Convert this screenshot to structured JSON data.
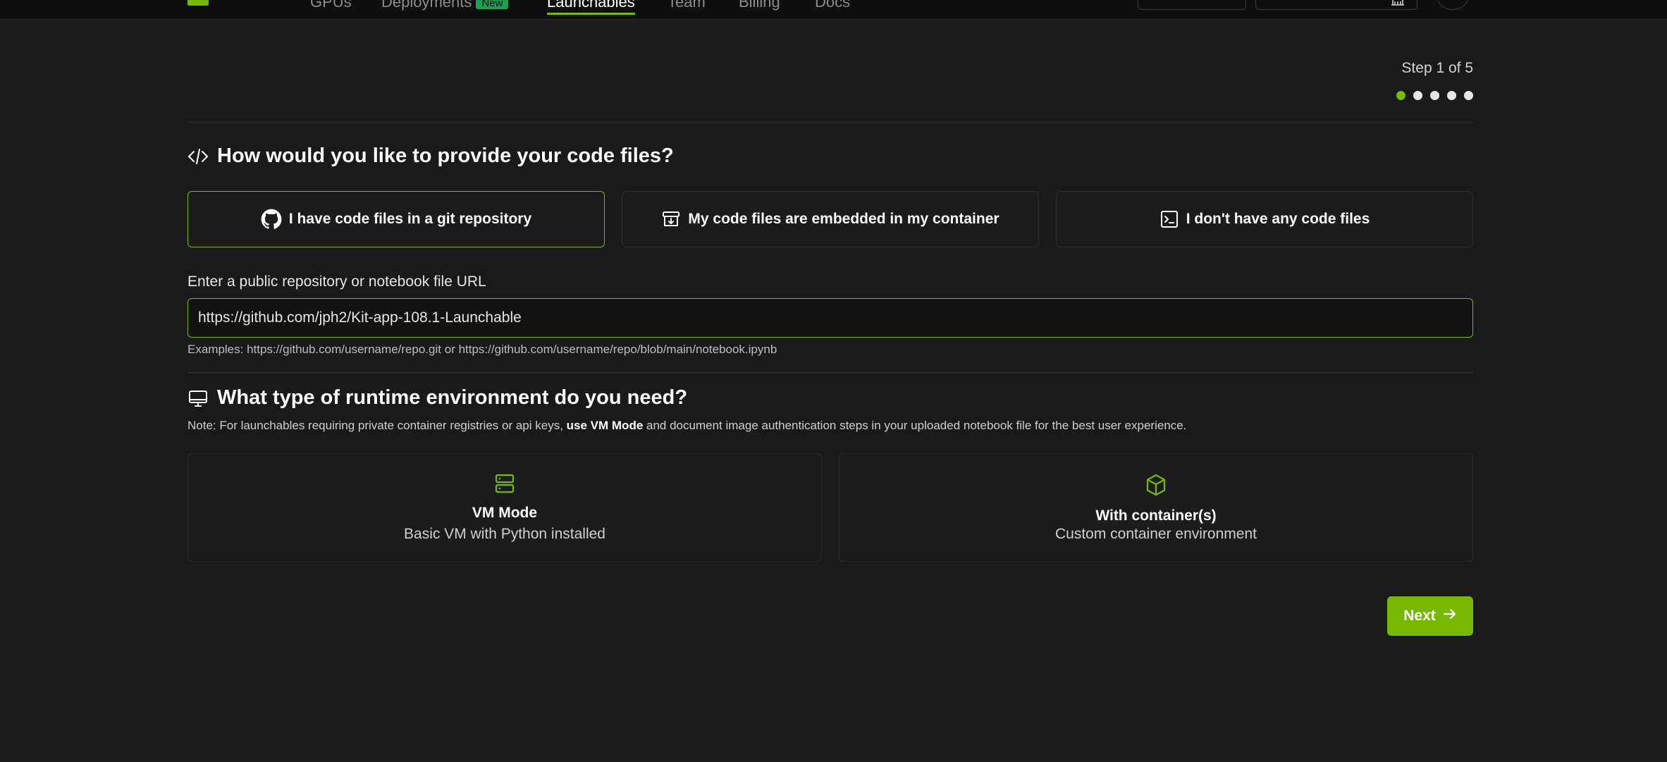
{
  "nav": {
    "items": [
      {
        "label": "GPUs"
      },
      {
        "label": "Deployments",
        "badge": "New"
      },
      {
        "label": "Launchables"
      },
      {
        "label": "Team"
      },
      {
        "label": "Billing"
      },
      {
        "label": "Docs"
      }
    ],
    "active_item": "Launchables"
  },
  "stepper": {
    "label": "Step 1 of 5",
    "current": 1,
    "total": 5
  },
  "code_section": {
    "title": "How would you like to provide your code files?",
    "icon": "code-icon",
    "options": [
      {
        "label": "I have code files in a git repository",
        "icon": "github-icon",
        "selected": true
      },
      {
        "label": "My code files are embedded in my container",
        "icon": "archive-download-icon",
        "selected": false
      },
      {
        "label": "I don't have any code files",
        "icon": "terminal-icon",
        "selected": false
      }
    ],
    "url_label": "Enter a public repository or notebook file URL",
    "url_value": "https://github.com/jph2/Kit-app-108.1-Launchable",
    "helper": "Examples: https://github.com/username/repo.git or https://github.com/username/repo/blob/main/notebook.ipynb"
  },
  "runtime_section": {
    "title": "What type of runtime environment do you need?",
    "icon": "monitor-icon",
    "note_prefix": "Note: For launchables requiring private container registries or api keys, ",
    "note_bold": "use VM Mode",
    "note_suffix": " and document image authentication steps in your uploaded notebook file for the best user experience.",
    "options": [
      {
        "title": "VM Mode",
        "subtitle": "Basic VM with Python installed",
        "icon": "server-icon"
      },
      {
        "title": "With container(s)",
        "subtitle": "Custom container environment",
        "icon": "box-icon"
      }
    ]
  },
  "actions": {
    "next_label": "Next"
  },
  "colors": {
    "accent": "#76b900",
    "background": "#1a1a1a"
  }
}
